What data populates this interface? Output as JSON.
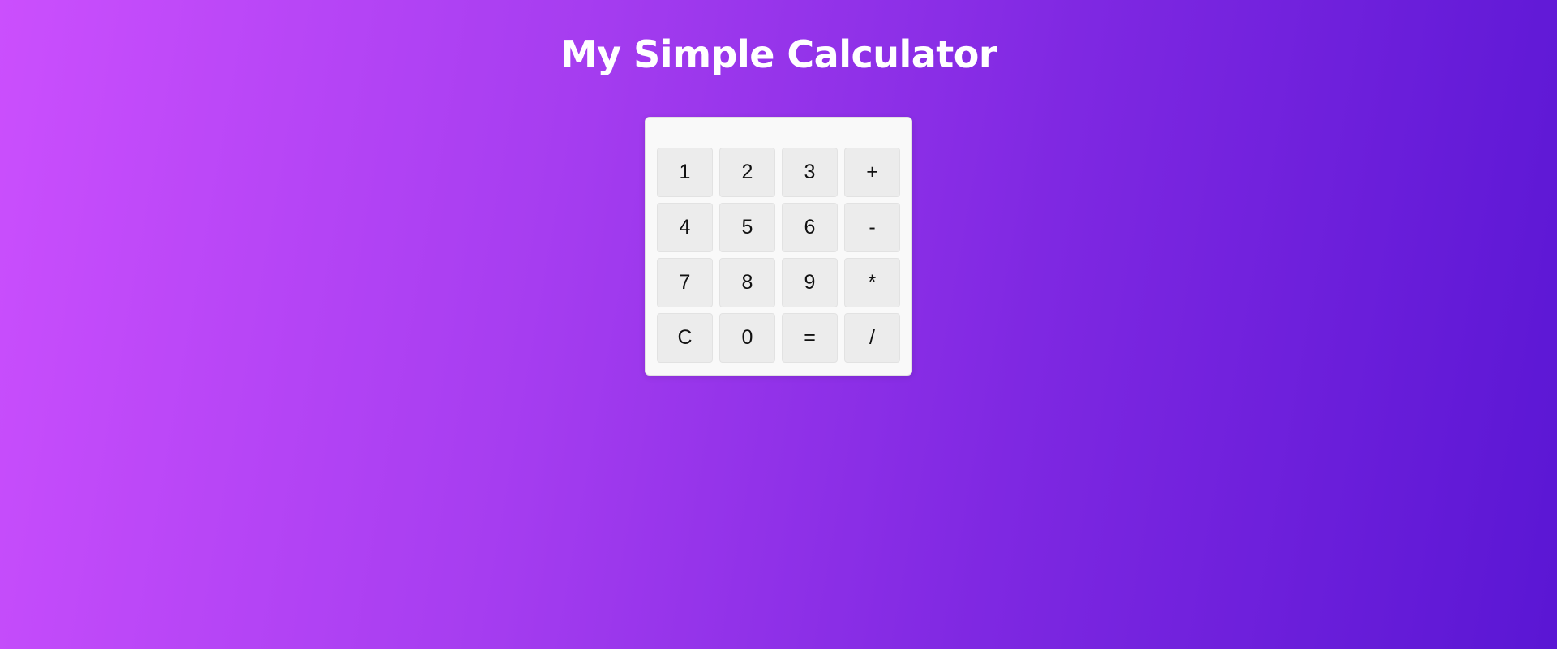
{
  "page": {
    "title": "My Simple Calculator"
  },
  "calculator": {
    "display_value": "",
    "keys": [
      {
        "name": "key-1",
        "label": "1"
      },
      {
        "name": "key-2",
        "label": "2"
      },
      {
        "name": "key-3",
        "label": "3"
      },
      {
        "name": "key-add",
        "label": "+"
      },
      {
        "name": "key-4",
        "label": "4"
      },
      {
        "name": "key-5",
        "label": "5"
      },
      {
        "name": "key-6",
        "label": "6"
      },
      {
        "name": "key-subtract",
        "label": "-"
      },
      {
        "name": "key-7",
        "label": "7"
      },
      {
        "name": "key-8",
        "label": "8"
      },
      {
        "name": "key-9",
        "label": "9"
      },
      {
        "name": "key-multiply",
        "label": "*"
      },
      {
        "name": "key-clear",
        "label": "C"
      },
      {
        "name": "key-0",
        "label": "0"
      },
      {
        "name": "key-equals",
        "label": "="
      },
      {
        "name": "key-divide",
        "label": "/"
      }
    ]
  },
  "colors": {
    "background_start": "#cb4ffd",
    "background_end": "#5a16d4",
    "panel": "#f9f9f9",
    "key": "#ececec",
    "title_text": "#ffffff"
  }
}
